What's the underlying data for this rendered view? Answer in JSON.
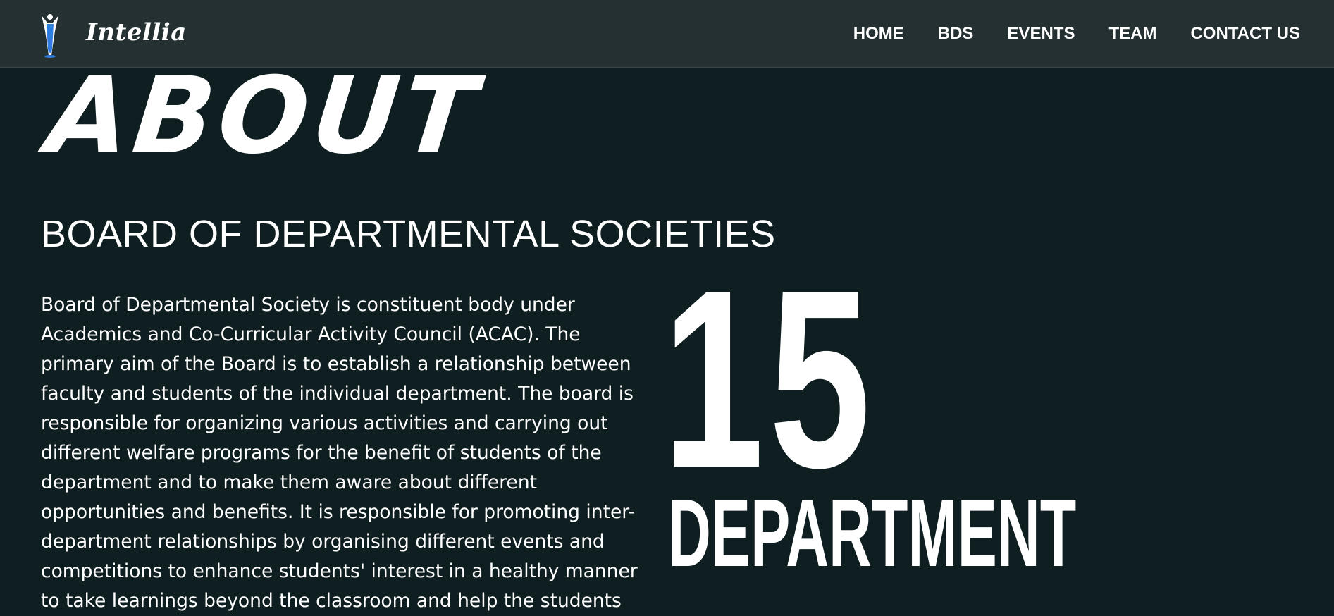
{
  "header": {
    "brand": "Intellia",
    "nav": {
      "home": "HOME",
      "bds": "BDS",
      "events": "EVENTS",
      "team": "TEAM",
      "contact": "CONTACT US"
    }
  },
  "about": {
    "title": "ABOUT",
    "heading": "BOARD OF DEPARTMENTAL SOCIETIES",
    "description": "Board of Departmental Society is constituent body under Academics and Co-Curricular Activity Council (ACAC). The primary aim of the Board is to establish a relationship between faculty and students of the individual department. The board is responsible for organizing various activities and carrying out different welfare programs for the benefit of students of the department and to make them aware about different opportunities and benefits. It is responsible for promoting inter-department relationships by organising different events and competitions to enhance students' interest in a healthy manner to take learnings beyond the classroom and help the students",
    "stat_number": "15",
    "stat_label": "DEPARTMENT"
  },
  "colors": {
    "background": "#0f1e21",
    "navbar": "#243032",
    "text": "#ffffff",
    "logo_accent": "#2f7de1"
  },
  "icons": {
    "logo": "torch-figure-logo"
  }
}
